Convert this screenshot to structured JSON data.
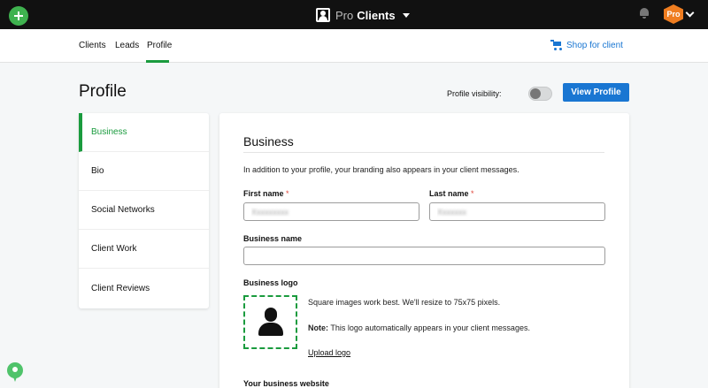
{
  "topbar": {
    "brand_prefix": "Pro",
    "brand_name": "Clients",
    "avatar_text": "Pro",
    "icons": [
      "plus-icon",
      "client-card-icon",
      "caret-down-icon",
      "bell-icon",
      "avatar-icon",
      "chevron-down-icon"
    ]
  },
  "subnav": {
    "tabs": [
      {
        "label": "Clients"
      },
      {
        "label": "Leads"
      },
      {
        "label": "Profile",
        "active": true
      }
    ],
    "shop_label": "Shop for client"
  },
  "header": {
    "title": "Profile",
    "visibility_label": "Profile visibility:",
    "visibility_on": false,
    "view_button": "View Profile"
  },
  "sidebar": {
    "items": [
      {
        "label": "Business",
        "active": true
      },
      {
        "label": "Bio"
      },
      {
        "label": "Social Networks"
      },
      {
        "label": "Client Work"
      },
      {
        "label": "Client Reviews"
      }
    ]
  },
  "form": {
    "title": "Business",
    "description": "In addition to your profile, your branding also appears in your client messages.",
    "first_name_label": "First name",
    "last_name_label": "Last name",
    "required_mark": "*",
    "first_name_value": "Xxxxxxxxx",
    "last_name_value": "Xxxxxxx",
    "business_name_label": "Business name",
    "business_name_value": "",
    "logo_label": "Business logo",
    "logo_hint": "Square images work best. We'll resize to 75x75 pixels.",
    "note_prefix": "Note:",
    "note_text": " This logo automatically appears in your client messages.",
    "upload_label": "Upload logo",
    "website_label": "Your business website"
  },
  "colors": {
    "accent_green": "#1a9b3e",
    "link_blue": "#1976d2",
    "topbar": "#111111",
    "avatar_orange": "#ef7d20"
  }
}
